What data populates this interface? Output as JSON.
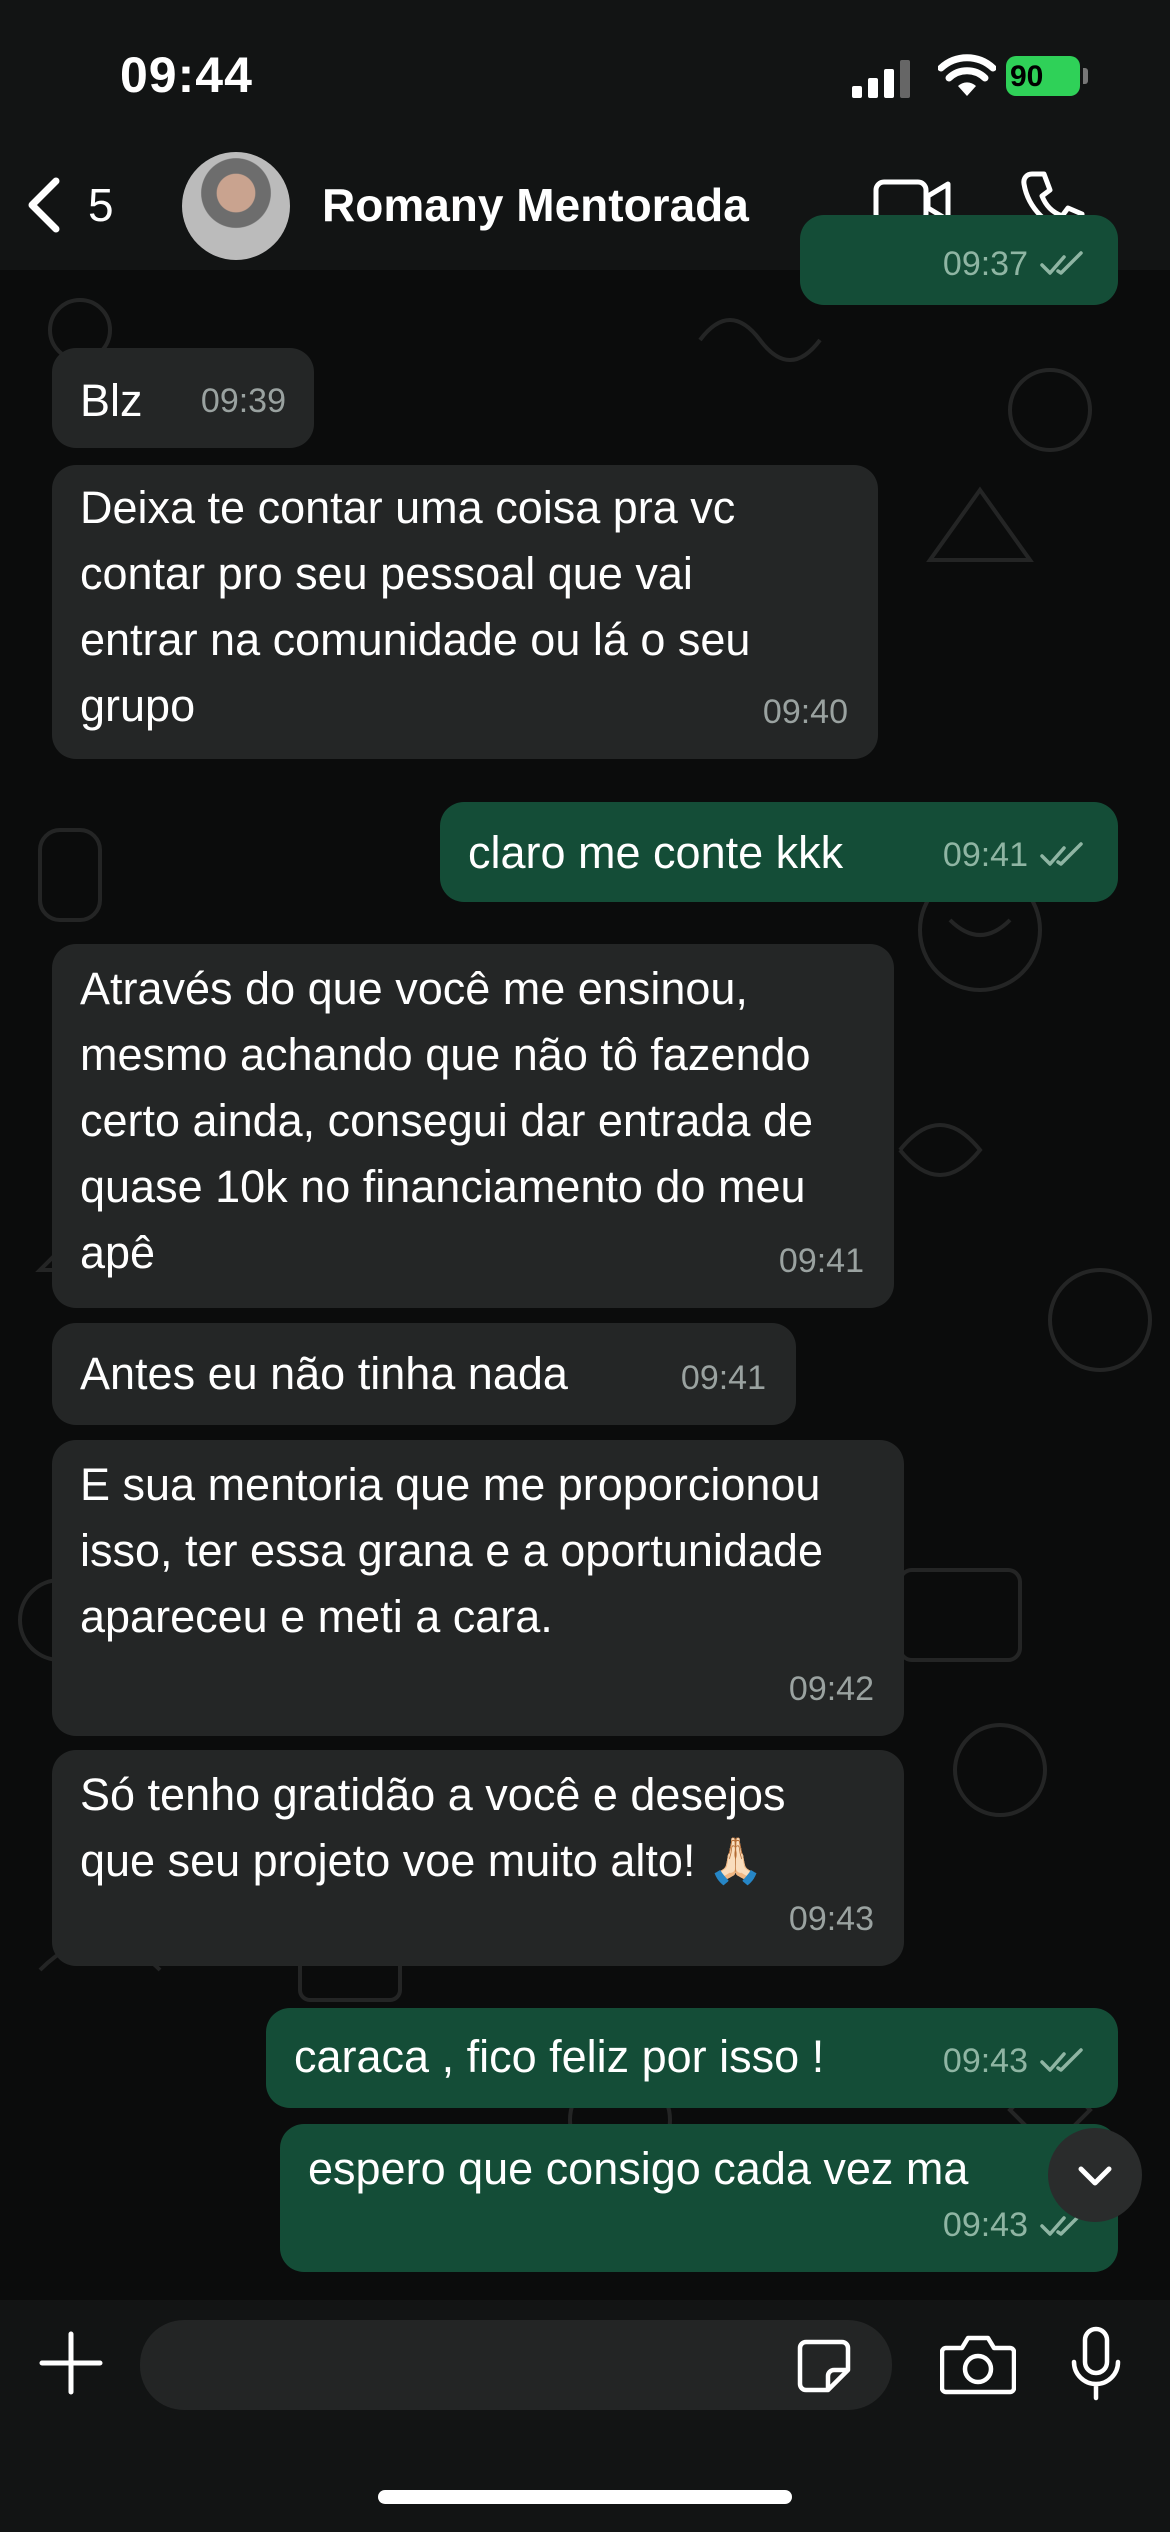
{
  "status": {
    "time": "09:44",
    "battery": "90"
  },
  "header": {
    "back_count": "5",
    "contact_name": "Romany Mentorada"
  },
  "messages": [
    {
      "dir": "out",
      "time": "09:37",
      "read": true,
      "text": ""
    },
    {
      "dir": "in",
      "time": "09:39",
      "text": "Blz"
    },
    {
      "dir": "in",
      "time": "09:40",
      "text": "Deixa te contar uma coisa pra vc contar pro seu pessoal que vai entrar na comunidade ou lá o seu grupo"
    },
    {
      "dir": "out",
      "time": "09:41",
      "read": true,
      "text": "claro me conte kkk"
    },
    {
      "dir": "in",
      "time": "09:41",
      "text": "Através do que você me ensinou, mesmo achando que não tô fazendo certo ainda, consegui dar entrada de quase 10k no financiamento do meu apê"
    },
    {
      "dir": "in",
      "time": "09:41",
      "text": "Antes eu não tinha nada"
    },
    {
      "dir": "in",
      "time": "09:42",
      "text": "E sua mentoria que me proporcionou isso, ter essa grana e a oportunidade apareceu e meti a cara."
    },
    {
      "dir": "in",
      "time": "09:43",
      "text": "Só tenho gratidão a você e desejos que seu projeto voe muito alto! 🙏🏻"
    },
    {
      "dir": "out",
      "time": "09:43",
      "read": true,
      "text": "caraca , fico feliz por isso !"
    },
    {
      "dir": "out",
      "time": "09:43",
      "read": true,
      "text": "espero que consigo cada vez ma"
    }
  ],
  "composer": {
    "placeholder": ""
  },
  "icons": {
    "back": "chevron-left-icon",
    "video": "video-camera-icon",
    "call": "phone-icon",
    "plus": "plus-icon",
    "sticker": "sticker-icon",
    "camera": "camera-icon",
    "mic": "microphone-icon",
    "scroll": "chevron-down-icon",
    "read": "double-check-icon"
  },
  "colors": {
    "incoming_bubble": "#242626",
    "outgoing_bubble": "#144d37",
    "battery": "#2fd158"
  }
}
